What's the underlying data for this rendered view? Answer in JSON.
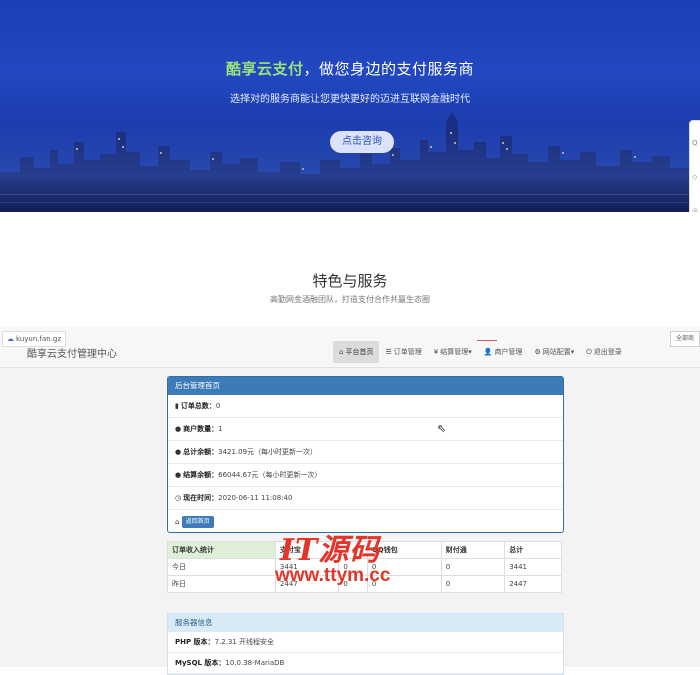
{
  "hero": {
    "brand": "酷享云支付",
    "title_rest": "，做您身边的支付服务商",
    "subtitle": "选择对的服务商能让您更快更好的迈进互联网金融时代",
    "button": "点击咨询"
  },
  "features": {
    "title": "特色与服务",
    "subtitle": "高勤网金酒融团队，打造支付合作共赢生态圈"
  },
  "admin": {
    "url_chip": "kuyun.fan.gz",
    "brand": "酷享云支付管理中心",
    "corner_chip": "全部商",
    "nav": [
      {
        "label": "平台首页",
        "icon": "home-icon",
        "glyph": "⌂"
      },
      {
        "label": "订单管理",
        "icon": "list-icon",
        "glyph": "☰"
      },
      {
        "label": "结算管理▾",
        "icon": "yen-icon",
        "glyph": "¥"
      },
      {
        "label": "商户管理",
        "icon": "user-icon",
        "glyph": "👤"
      },
      {
        "label": "网站配置▾",
        "icon": "gear-icon",
        "glyph": "⚙"
      },
      {
        "label": "退出登录",
        "icon": "power-icon",
        "glyph": "⏻"
      }
    ],
    "panel": {
      "title": "后台管理首页",
      "rows": [
        {
          "label": "订单总数：",
          "value": "0",
          "icon": "bar-chart-icon",
          "glyph": "▮"
        },
        {
          "label": "商户数量：",
          "value": "1",
          "icon": "drop-icon",
          "glyph": "●"
        },
        {
          "label": "总计余额：",
          "value": "3421.09元（每小时更新一次）",
          "icon": "drop-icon",
          "glyph": "●"
        },
        {
          "label": "结算余额：",
          "value": "66044.67元（每小时更新一次）",
          "icon": "drop-icon",
          "glyph": "●"
        },
        {
          "label": "现在时间：",
          "value": "2020-06-11 11:08:40",
          "icon": "clock-icon",
          "glyph": "◷"
        }
      ],
      "home_button": "返回首页"
    },
    "stats": {
      "headers": [
        "订单收入统计",
        "支付宝",
        "",
        "QQ钱包",
        "财付通",
        "总计"
      ],
      "rows": [
        [
          "今日",
          "3441",
          "0",
          "0",
          "0",
          "3441"
        ],
        [
          "昨日",
          "2447",
          "0",
          "0",
          "0",
          "2447"
        ]
      ]
    },
    "server": {
      "title": "服务器信息",
      "rows": [
        {
          "label": "PHP 版本：",
          "value": "7.2.31 开线程安全"
        },
        {
          "label": "MySQL 版本：",
          "value": "10.0.38-MariaDB"
        }
      ]
    }
  },
  "watermark": {
    "line1": "IT源码",
    "line2": "www.ttym.cc"
  }
}
